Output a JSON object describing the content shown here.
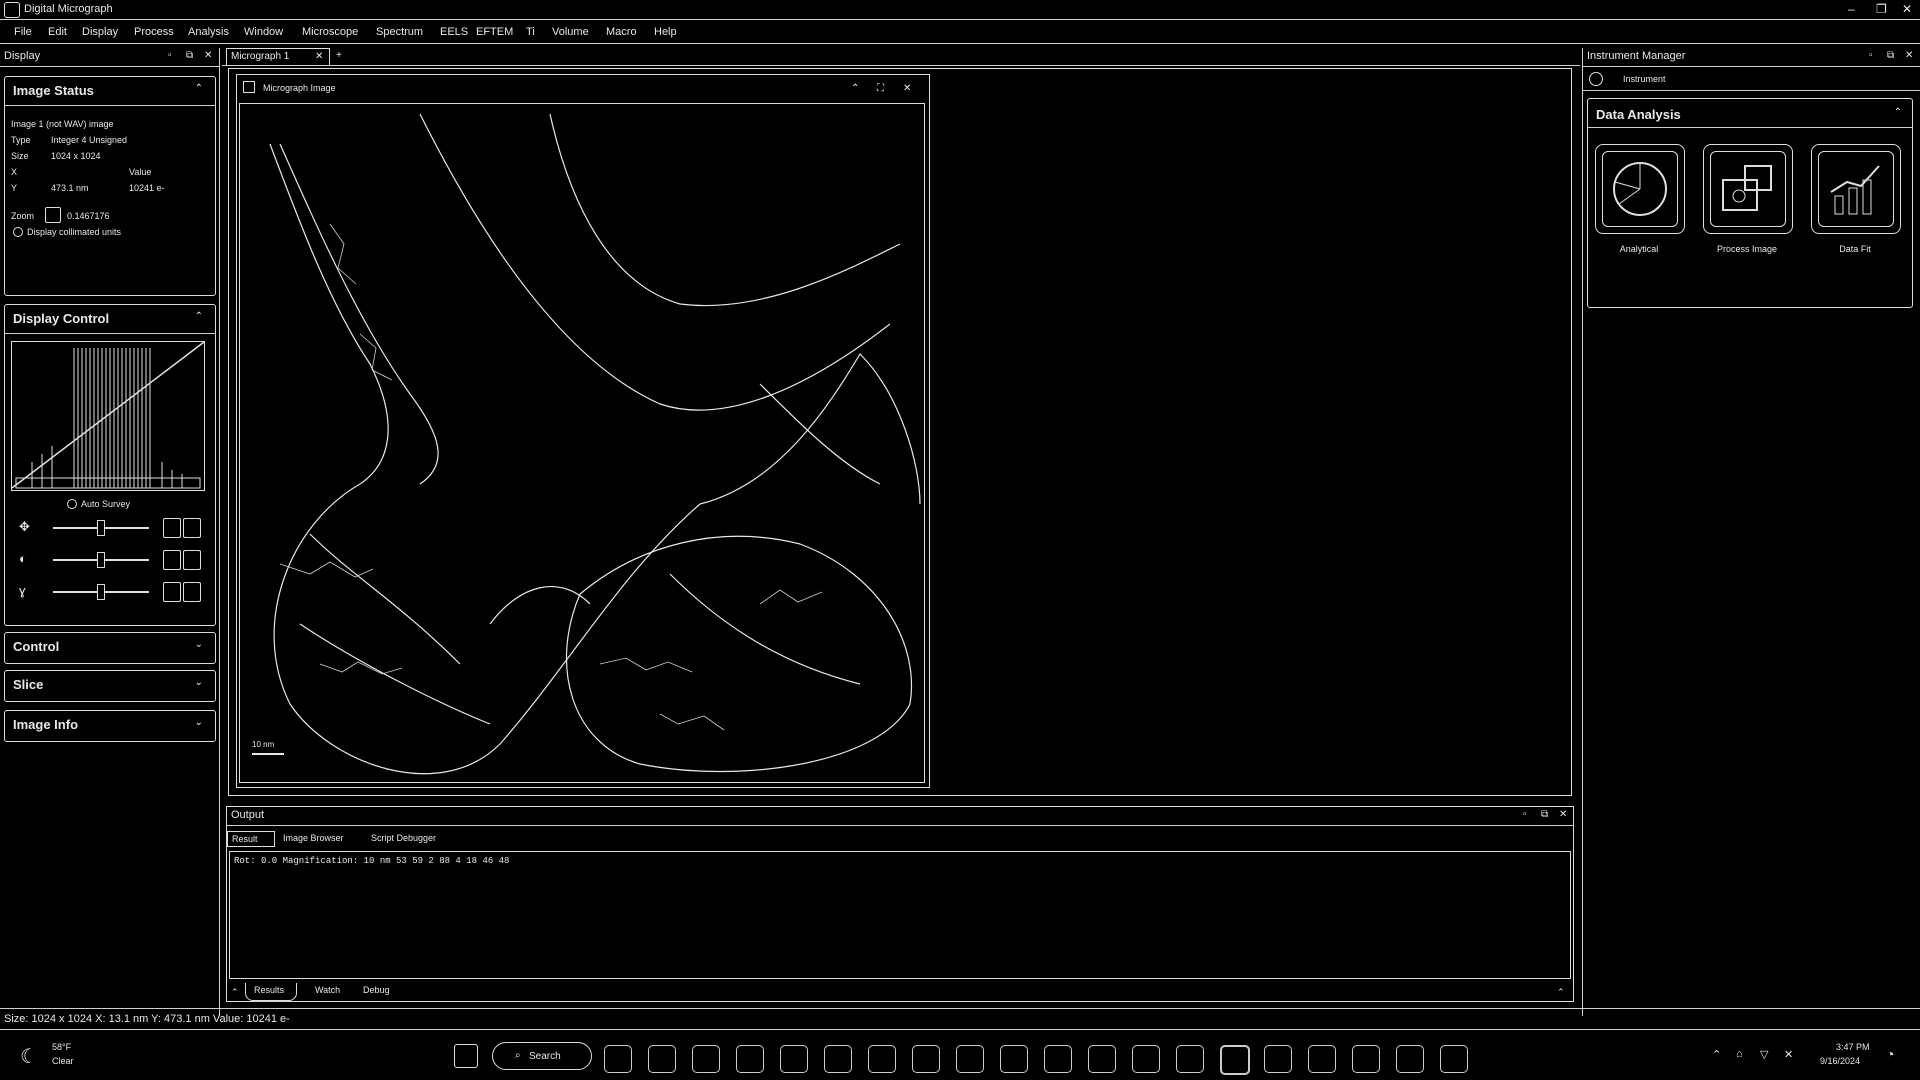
{
  "window": {
    "title": "Digital Micrograph"
  },
  "menu": [
    "File",
    "Edit",
    "Display",
    "Process",
    "Analysis",
    "Window",
    "Microscope",
    "Spectrum",
    "EELS",
    "EFTEM",
    "Ti",
    "Volume",
    "Macro",
    "Help"
  ],
  "left_panel": {
    "title": "Display",
    "image_status": {
      "title": "Image Status",
      "line1": "Image 1 (not WAV) image",
      "type_label": "Type",
      "type_value": "Integer 4 Unsigned",
      "size_label": "Size",
      "size_value": "1024 x 1024",
      "x_label": "X",
      "value_label": "Value",
      "y_label": "Y",
      "y_value": "473.1 nm",
      "value_value": "10241 e-",
      "zoom_label": "Zoom",
      "zoom_value": "0.1467176",
      "checkbox": "Display collimated units"
    },
    "display_control": {
      "title": "Display Control",
      "auto": "Auto Survey"
    },
    "sections": [
      "Control",
      "Slice",
      "Image Info"
    ]
  },
  "doc_tab": {
    "label": "Micrograph 1"
  },
  "image_window": {
    "title": "Micrograph Image",
    "scalebar": "10 nm"
  },
  "output": {
    "title": "Output",
    "tabs": [
      "Result",
      "Image Browser",
      "Script Debugger"
    ],
    "text": "Rot: 0.0  Magnification: 10 nm  53 59 2 88  4 18 46 48",
    "bottom_tabs": [
      "Results",
      "Watch",
      "Debug"
    ]
  },
  "right_panel": {
    "title": "Instrument Manager",
    "sub": "Instrument",
    "data_analysis": {
      "title": "Data Analysis",
      "tiles": [
        "Analytical",
        "Process Image",
        "Data Fit"
      ]
    }
  },
  "status_bar": "Size: 1024 x 1024  X: 13.1 nm  Y: 473.1 nm  Value: 10241 e-",
  "taskbar": {
    "weather_temp": "58°F",
    "weather_text": "Clear",
    "search": "Search",
    "time": "3:47 PM",
    "date": "9/16/2024"
  }
}
